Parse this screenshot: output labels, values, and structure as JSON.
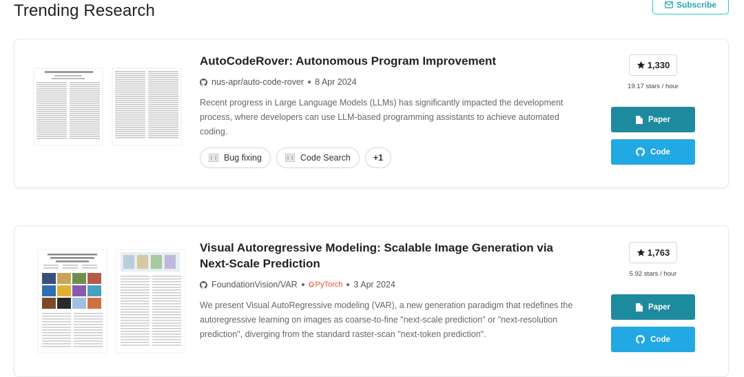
{
  "header": {
    "title": "Trending Research",
    "subscribe_label": "Subscribe"
  },
  "papers": [
    {
      "title": "AutoCodeRover: Autonomous Program Improvement",
      "repo": "nus-apr/auto-code-rover",
      "framework": "",
      "date": "8 Apr 2024",
      "abstract": "Recent progress in Large Language Models (LLMs) has significantly impacted the development process, where developers can use LLM-based programming assistants to achieve automated coding.",
      "tags": [
        "Bug fixing",
        "Code Search"
      ],
      "more_tags": "+1",
      "stars": "1,330",
      "stars_rate": "19.17 stars / hour",
      "paper_label": "Paper",
      "code_label": "Code"
    },
    {
      "title": "Visual Autoregressive Modeling: Scalable Image Generation via Next-Scale Prediction",
      "repo": "FoundationVision/VAR",
      "framework": "PyTorch",
      "date": "3 Apr 2024",
      "abstract": "We present Visual AutoRegressive modeling (VAR), a new generation paradigm that redefines the autoregressive learning on images as coarse-to-fine \"next-scale prediction\" or \"next-resolution prediction\", diverging from the standard raster-scan \"next-token prediction\".",
      "tags": [],
      "more_tags": "",
      "stars": "1,763",
      "stars_rate": "5.92 stars / hour",
      "paper_label": "Paper",
      "code_label": "Code"
    }
  ],
  "icons": {
    "subscribe": "envelope-icon",
    "repo": "github-icon",
    "star": "star-icon",
    "paper": "document-icon",
    "code": "github-icon",
    "tag": "task-icon",
    "framework": "pytorch-icon"
  },
  "colors": {
    "accent": "#21cbce",
    "paper_button": "#1e8a9e",
    "code_button": "#22a8e3",
    "pytorch": "#ee4c2c"
  }
}
